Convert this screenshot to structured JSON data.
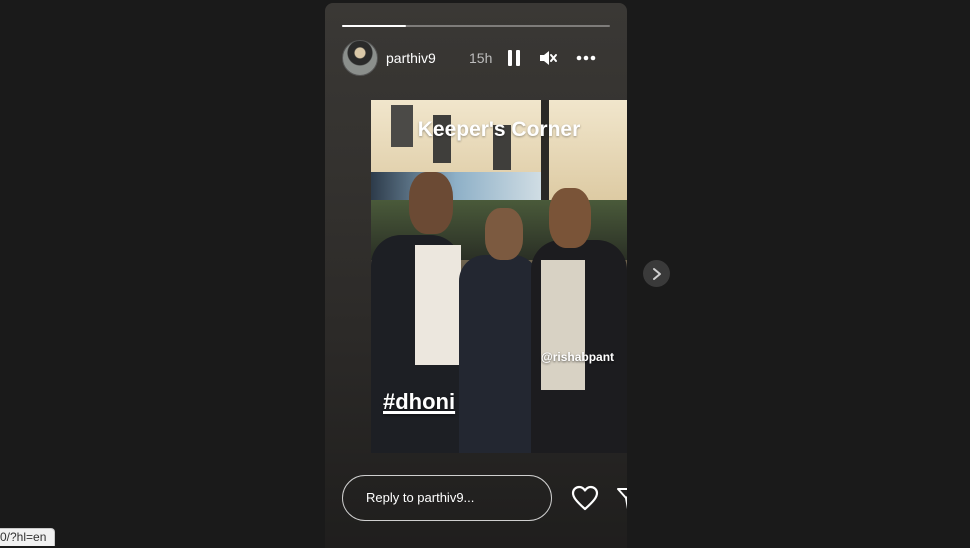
{
  "story": {
    "progress": 0.24,
    "username": "parthiv9",
    "time": "15h",
    "controls": {
      "pause_icon": "pause-icon",
      "mute_icon": "muted-speaker-icon",
      "more_icon": "more-horizontal-icon"
    },
    "photo": {
      "title": "Keeper's Corner",
      "mention": "@rishabpant",
      "hashtag": "#dhoni"
    },
    "reply_placeholder": "Reply to parthiv9...",
    "like_icon": "heart-icon",
    "share_icon": "send-icon"
  },
  "navigation": {
    "next_icon": "chevron-right-icon"
  },
  "status_bar": {
    "url": "0/?hl=en"
  }
}
